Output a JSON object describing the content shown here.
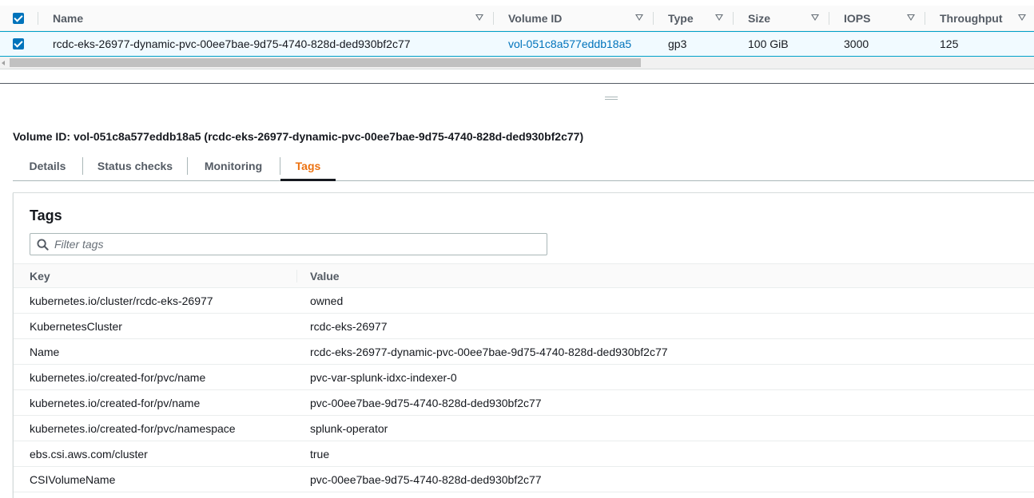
{
  "volumes_table": {
    "columns": [
      "Name",
      "Volume ID",
      "Type",
      "Size",
      "IOPS",
      "Throughput"
    ],
    "rows": [
      {
        "selected": true,
        "name": "rcdc-eks-26977-dynamic-pvc-00ee7bae-9d75-4740-828d-ded930bf2c77",
        "volume_id": "vol-051c8a577eddb18a5",
        "type": "gp3",
        "size": "100 GiB",
        "iops": "3000",
        "throughput": "125"
      }
    ]
  },
  "details": {
    "title": "Volume ID: vol-051c8a577eddb18a5 (rcdc-eks-26977-dynamic-pvc-00ee7bae-9d75-4740-828d-ded930bf2c77)",
    "tabs": [
      {
        "label": "Details",
        "active": false
      },
      {
        "label": "Status checks",
        "active": false
      },
      {
        "label": "Monitoring",
        "active": false
      },
      {
        "label": "Tags",
        "active": true
      }
    ],
    "tags": {
      "heading": "Tags",
      "filter_placeholder": "Filter tags",
      "columns": {
        "key": "Key",
        "value": "Value"
      },
      "rows": [
        {
          "key": "kubernetes.io/cluster/rcdc-eks-26977",
          "value": "owned"
        },
        {
          "key": "KubernetesCluster",
          "value": "rcdc-eks-26977"
        },
        {
          "key": "Name",
          "value": "rcdc-eks-26977-dynamic-pvc-00ee7bae-9d75-4740-828d-ded930bf2c77"
        },
        {
          "key": "kubernetes.io/created-for/pvc/name",
          "value": "pvc-var-splunk-idxc-indexer-0"
        },
        {
          "key": "kubernetes.io/created-for/pv/name",
          "value": "pvc-00ee7bae-9d75-4740-828d-ded930bf2c77"
        },
        {
          "key": "kubernetes.io/created-for/pvc/namespace",
          "value": "splunk-operator"
        },
        {
          "key": "ebs.csi.aws.com/cluster",
          "value": "true"
        },
        {
          "key": "CSIVolumeName",
          "value": "pvc-00ee7bae-9d75-4740-828d-ded930bf2c77"
        }
      ]
    }
  },
  "colors": {
    "accent_link": "#0073bb",
    "active_tab": "#ec7211",
    "selected_row_bg": "#f1faff",
    "selected_row_border": "#00a1c9"
  },
  "icons": [
    "checkbox-checked-icon",
    "sort-caret-icon",
    "search-icon",
    "drag-handle-icon",
    "scroll-left-arrow-icon"
  ]
}
